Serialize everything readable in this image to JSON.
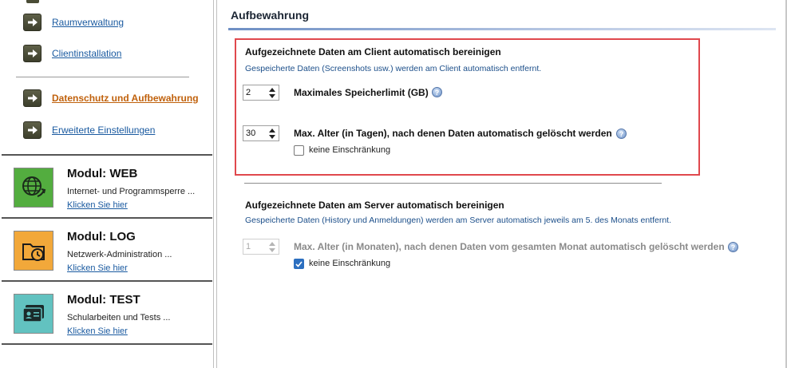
{
  "sidebar": {
    "nav": [
      {
        "label": "Raumverwaltung",
        "icon": "arrow-right-icon"
      },
      {
        "label": "Clientinstallation",
        "icon": "arrow-right-icon"
      },
      {
        "label": "Datenschutz und Aufbewahrung",
        "icon": "arrow-right-icon",
        "active": true
      },
      {
        "label": "Erweiterte Einstellungen",
        "icon": "arrow-right-icon"
      }
    ],
    "modules": [
      {
        "title": "Modul: WEB",
        "desc": "Internet- und Programmsperre ...",
        "link": "Klicken Sie hier",
        "icon": "globe-icon",
        "color": "#53ad3f"
      },
      {
        "title": "Modul: LOG",
        "desc": "Netzwerk-Administration ...",
        "link": "Klicken Sie hier",
        "icon": "folder-clock-icon",
        "color": "#f2a83a"
      },
      {
        "title": "Modul: TEST",
        "desc": "Schularbeiten und Tests ...",
        "link": "Klicken Sie hier",
        "icon": "id-card-icon",
        "color": "#62c2c0"
      }
    ]
  },
  "main": {
    "title": "Aufbewahrung",
    "client": {
      "heading": "Aufgezeichnete Daten am Client automatisch bereinigen",
      "subtext": "Gespeicherte Daten (Screenshots usw.) werden am Client automatisch entfernt.",
      "storage_value": "2",
      "storage_label": "Maximales Speicherlimit (GB)",
      "age_value": "30",
      "age_label": "Max. Alter (in Tagen), nach denen Daten automatisch gelöscht werden",
      "no_limit_label": "keine Einschränkung",
      "no_limit_checked": false
    },
    "server": {
      "heading": "Aufgezeichnete Daten am Server automatisch bereinigen",
      "subtext": "Gespeicherte Daten (History und Anmeldungen) werden am Server automatisch jeweils am 5. des Monats entfernt.",
      "age_value": "1",
      "age_label": "Max. Alter (in Monaten), nach denen Daten vom gesamten Monat automatisch gelöscht werden",
      "no_limit_label": "keine Einschränkung",
      "no_limit_checked": true
    },
    "help_symbol": "?"
  },
  "colors": {
    "link": "#1a5aa0",
    "active_link": "#c0610c",
    "highlight_border": "#e0484d",
    "checkbox_checked": "#2c6fc0"
  }
}
